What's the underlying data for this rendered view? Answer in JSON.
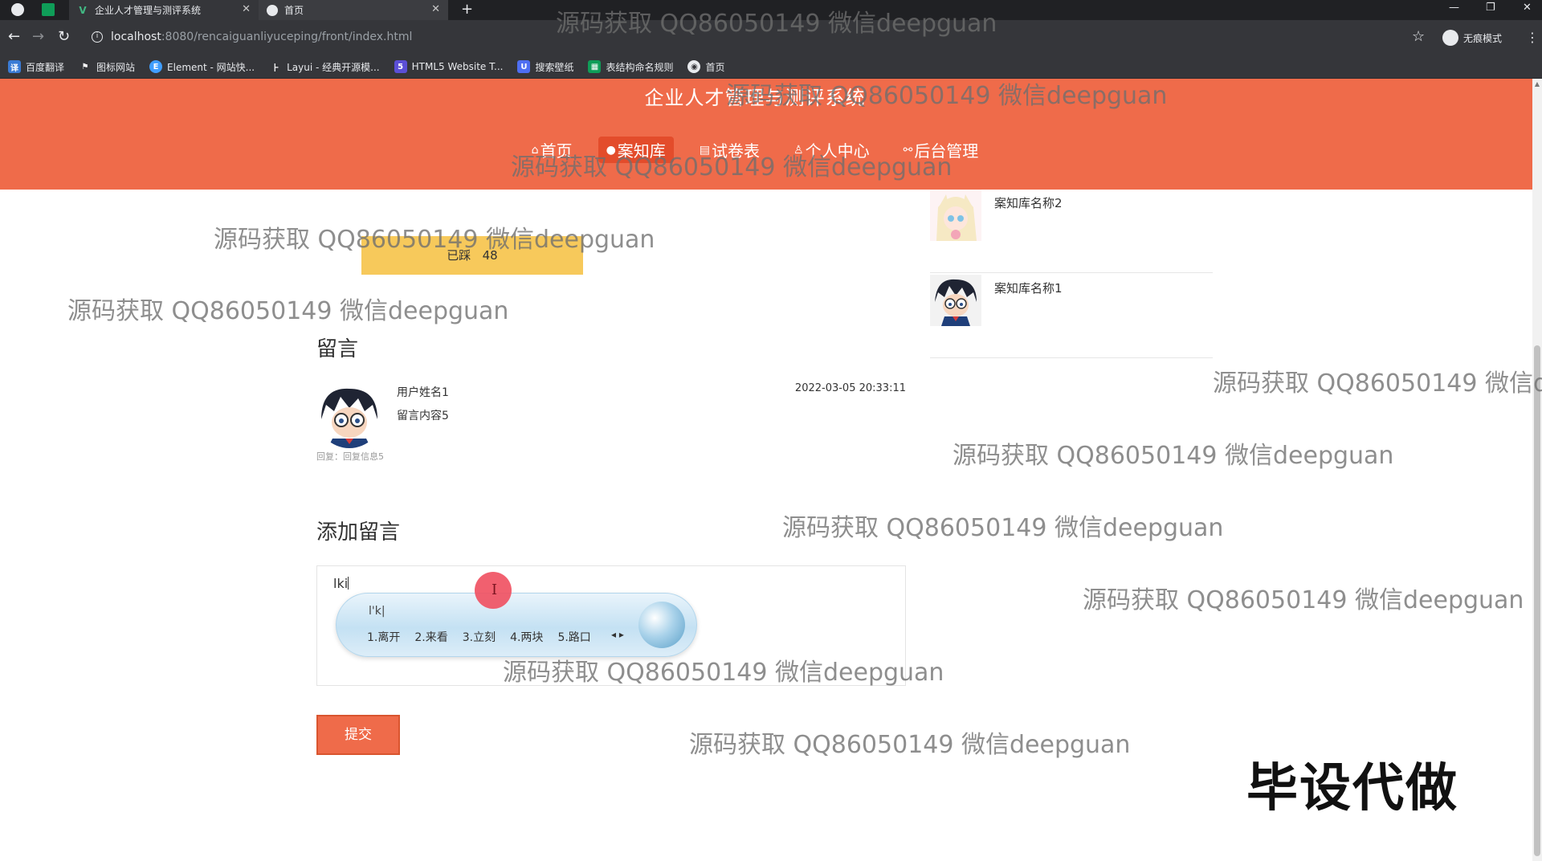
{
  "browser": {
    "tabs": [
      {
        "title": "企业人才管理与测评系统",
        "active": false
      },
      {
        "title": "首页",
        "active": true
      }
    ],
    "url_host": "localhost",
    "url_path": ":8080/rencaiguanliyuceping/front/index.html",
    "profile_label": "无痕模式",
    "bookmarks": [
      {
        "label": "百度翻译",
        "icon": "translate-icon",
        "color": "#3a7bd5"
      },
      {
        "label": "图标网站",
        "icon": "flag-icon",
        "color": "#35363a"
      },
      {
        "label": "Element - 网站快...",
        "icon": "element-icon",
        "color": "#409eff"
      },
      {
        "label": "Layui - 经典开源模...",
        "icon": "layui-icon",
        "color": "#35363a"
      },
      {
        "label": "HTML5 Website T...",
        "icon": "html5-icon",
        "color": "#5b4fd6"
      },
      {
        "label": "搜索壁纸",
        "icon": "wallpaper-icon",
        "color": "#4e6ef2"
      },
      {
        "label": "表结构命名规则",
        "icon": "sheet-icon",
        "color": "#0f9d58"
      },
      {
        "label": "首页",
        "icon": "globe-icon",
        "color": "#35363a"
      }
    ]
  },
  "header": {
    "title": "企业人才管理与测评系统",
    "nav": [
      {
        "label": "首页",
        "icon": "home-icon",
        "active": false
      },
      {
        "label": "案知库",
        "icon": "book-icon",
        "active": true
      },
      {
        "label": "试卷表",
        "icon": "paper-icon",
        "active": false
      },
      {
        "label": "个人中心",
        "icon": "user-icon",
        "active": false
      },
      {
        "label": "后台管理",
        "icon": "link-icon",
        "active": false
      }
    ]
  },
  "main": {
    "step_label": "已踩",
    "step_count": "48",
    "side_list": [
      {
        "name": "案知库名称2"
      },
      {
        "name": "案知库名称1"
      }
    ],
    "comments_title": "留言",
    "comment": {
      "user": "用户姓名1",
      "content": "留言内容5",
      "time": "2022-03-05 20:33:11",
      "reply": "回复：回复信息5"
    },
    "add_title": "添加留言",
    "input_value": "lki",
    "ime": {
      "pinyin": "l'k|",
      "candidates": [
        "1.离开",
        "2.来看",
        "3.立刻",
        "4.两块",
        "5.路口"
      ]
    },
    "submit_label": "提交"
  },
  "overlay": {
    "watermark": "源码获取 QQ86050149 微信deepguan",
    "badge": "毕设代做"
  }
}
